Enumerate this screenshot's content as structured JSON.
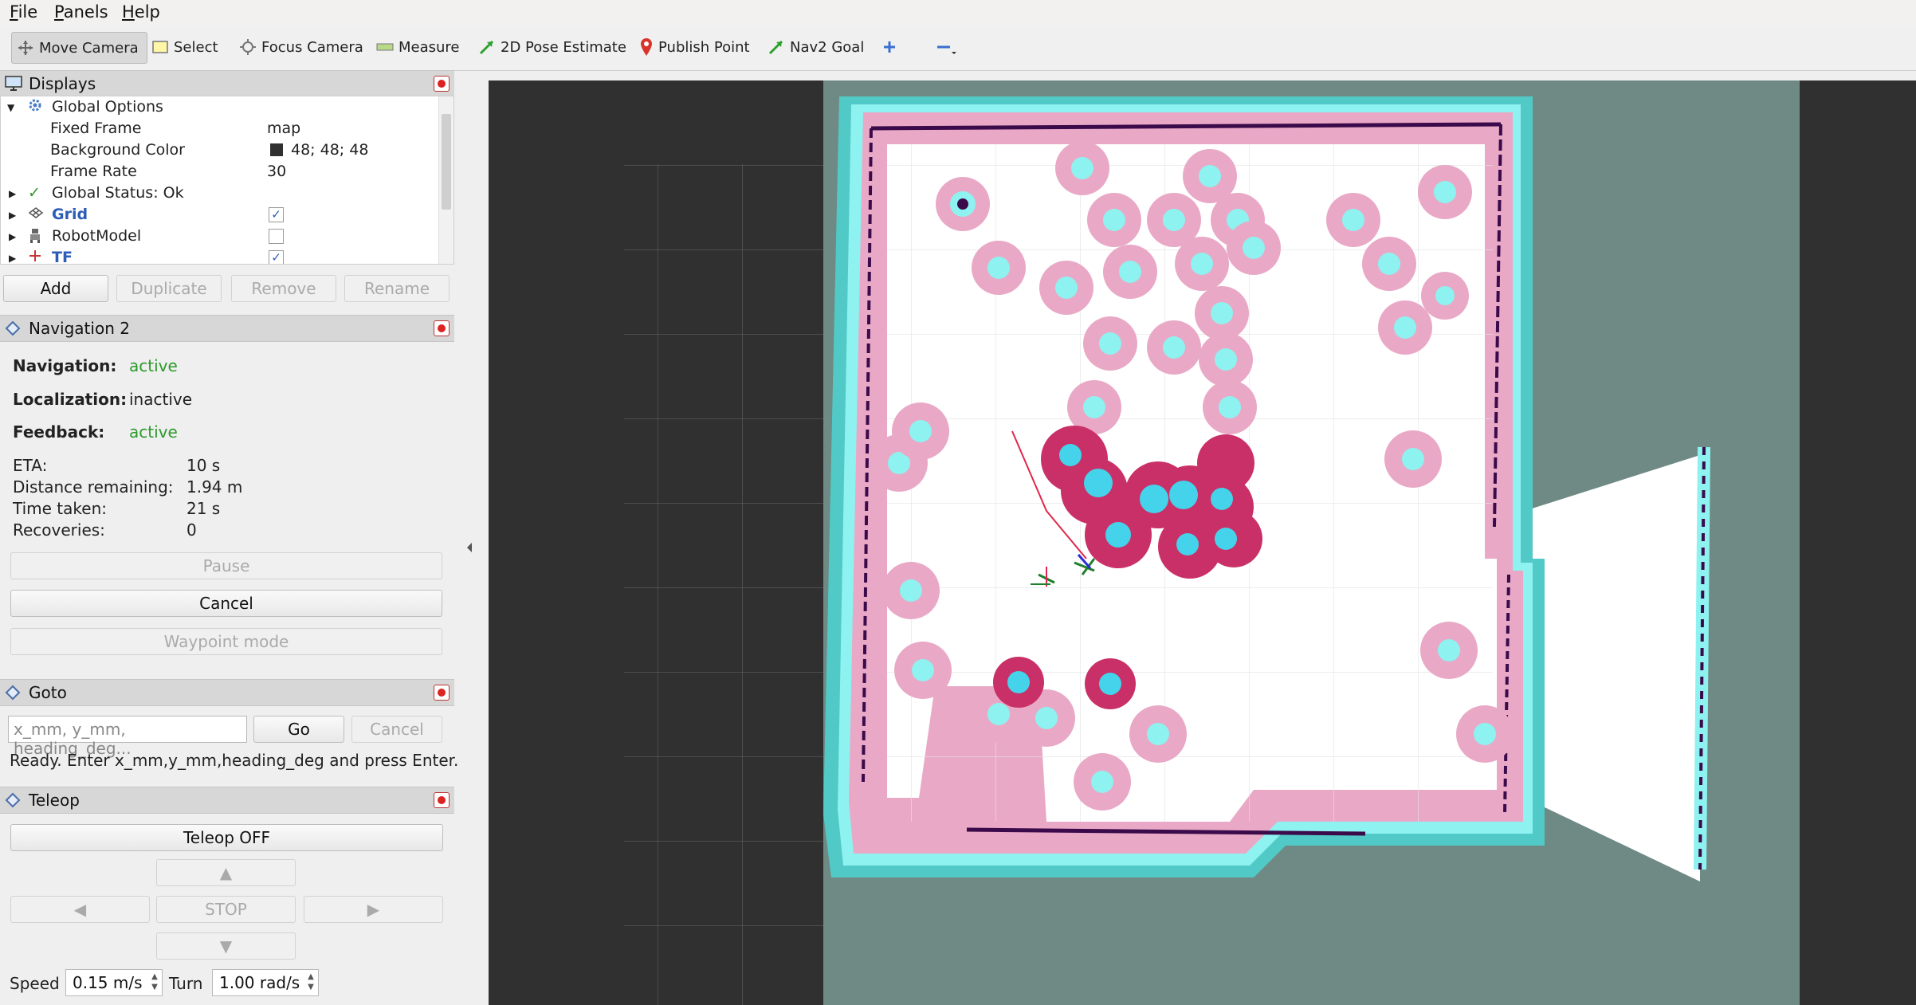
{
  "menu": {
    "file": "File",
    "panels": "Panels",
    "help": "Help"
  },
  "toolbar": {
    "move_camera": "Move Camera",
    "select": "Select",
    "focus_camera": "Focus Camera",
    "measure": "Measure",
    "pose_estimate": "2D Pose Estimate",
    "publish_point": "Publish Point",
    "nav2_goal": "Nav2 Goal"
  },
  "displays": {
    "title": "Displays",
    "rows": [
      {
        "label": "Global Options"
      },
      {
        "label": "Fixed Frame",
        "value": "map"
      },
      {
        "label": "Background Color",
        "value": "48; 48; 48"
      },
      {
        "label": "Frame Rate",
        "value": "30"
      },
      {
        "label": "Global Status: Ok"
      },
      {
        "label": "Grid"
      },
      {
        "label": "RobotModel"
      },
      {
        "label": "TF"
      }
    ],
    "buttons": {
      "add": "Add",
      "duplicate": "Duplicate",
      "remove": "Remove",
      "rename": "Rename"
    }
  },
  "navigation": {
    "title": "Navigation 2",
    "nav_label": "Navigation:",
    "nav_value": "active",
    "loc_label": "Localization:",
    "loc_value": "inactive",
    "fb_label": "Feedback:",
    "fb_value": "active",
    "eta_label": "ETA:",
    "eta_value": "10 s",
    "dist_label": "Distance remaining:",
    "dist_value": "1.94 m",
    "time_label": "Time taken:",
    "time_value": "21 s",
    "rec_label": "Recoveries:",
    "rec_value": "0",
    "pause": "Pause",
    "cancel": "Cancel",
    "waypoint": "Waypoint mode"
  },
  "goto": {
    "title": "Goto",
    "placeholder": "x_mm, y_mm, heading_deg...",
    "go": "Go",
    "cancel": "Cancel",
    "status": "Ready. Enter x_mm,y_mm,heading_deg and press Enter."
  },
  "teleop": {
    "title": "Teleop",
    "toggle": "Teleop OFF",
    "up": "▲",
    "left": "◀",
    "stop": "STOP",
    "right": "▶",
    "down": "▼",
    "speed_label": "Speed",
    "speed_value": "0.15 m/s",
    "turn_label": "Turn",
    "turn_value": "1.00 rad/s"
  },
  "colors": {
    "background": "#303030",
    "accent_blue": "#2b5cb7",
    "active_green": "#2a9a2a"
  }
}
